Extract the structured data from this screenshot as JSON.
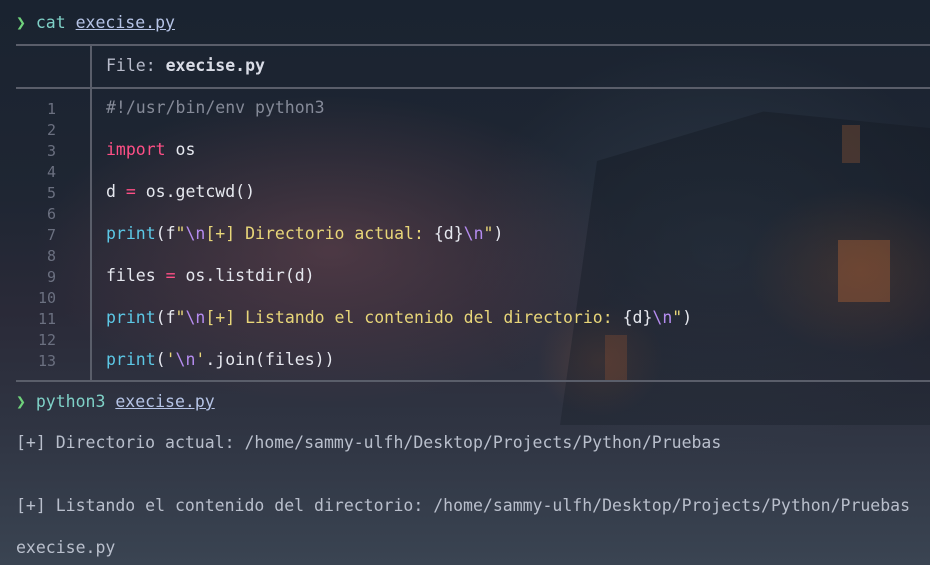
{
  "terminal": {
    "prompt_symbol": "❯",
    "commands": [
      {
        "cmd": "cat",
        "arg": "execise.py"
      },
      {
        "cmd": "python3",
        "arg": "execise.py"
      }
    ]
  },
  "file_viewer": {
    "header_label": "File:",
    "filename": "execise.py",
    "line_numbers": [
      "1",
      "2",
      "3",
      "4",
      "5",
      "6",
      "7",
      "8",
      "9",
      "10",
      "11",
      "12",
      "13"
    ],
    "code": {
      "l1": "#!/usr/bin/env python3",
      "l3_kw": "import",
      "l3_mod": " os",
      "l5_a": "d ",
      "l5_op": "=",
      "l5_b": " os.getcwd()",
      "l7_fn": "print",
      "l7_p1": "(f",
      "l7_q1": "\"",
      "l7_e1": "\\n",
      "l7_s1": "[+] Directorio actual: ",
      "l7_v": "{d}",
      "l7_e2": "\\n",
      "l7_q2": "\"",
      "l7_p2": ")",
      "l9_a": "files ",
      "l9_op": "=",
      "l9_b": " os.listdir(d)",
      "l11_fn": "print",
      "l11_p1": "(f",
      "l11_q1": "\"",
      "l11_e1": "\\n",
      "l11_s1": "[+] Listando el contenido del directorio: ",
      "l11_v": "{d}",
      "l11_e2": "\\n",
      "l11_q2": "\"",
      "l11_p2": ")",
      "l13_fn": "print",
      "l13_p1": "(",
      "l13_q1": "'",
      "l13_e1": "\\n",
      "l13_q2": "'",
      "l13_rest": ".join(files))"
    }
  },
  "output": {
    "line1": "[+] Directorio actual: /home/sammy-ulfh/Desktop/Projects/Python/Pruebas",
    "line2": "[+] Listando el contenido del directorio: /home/sammy-ulfh/Desktop/Projects/Python/Pruebas",
    "line3": "execise.py"
  },
  "colors": {
    "prompt": "#6fd27b",
    "keyword": "#ff4f86",
    "function": "#5cc8e6",
    "string": "#e8d679",
    "escape": "#b58cf0",
    "comment": "#858a98"
  }
}
